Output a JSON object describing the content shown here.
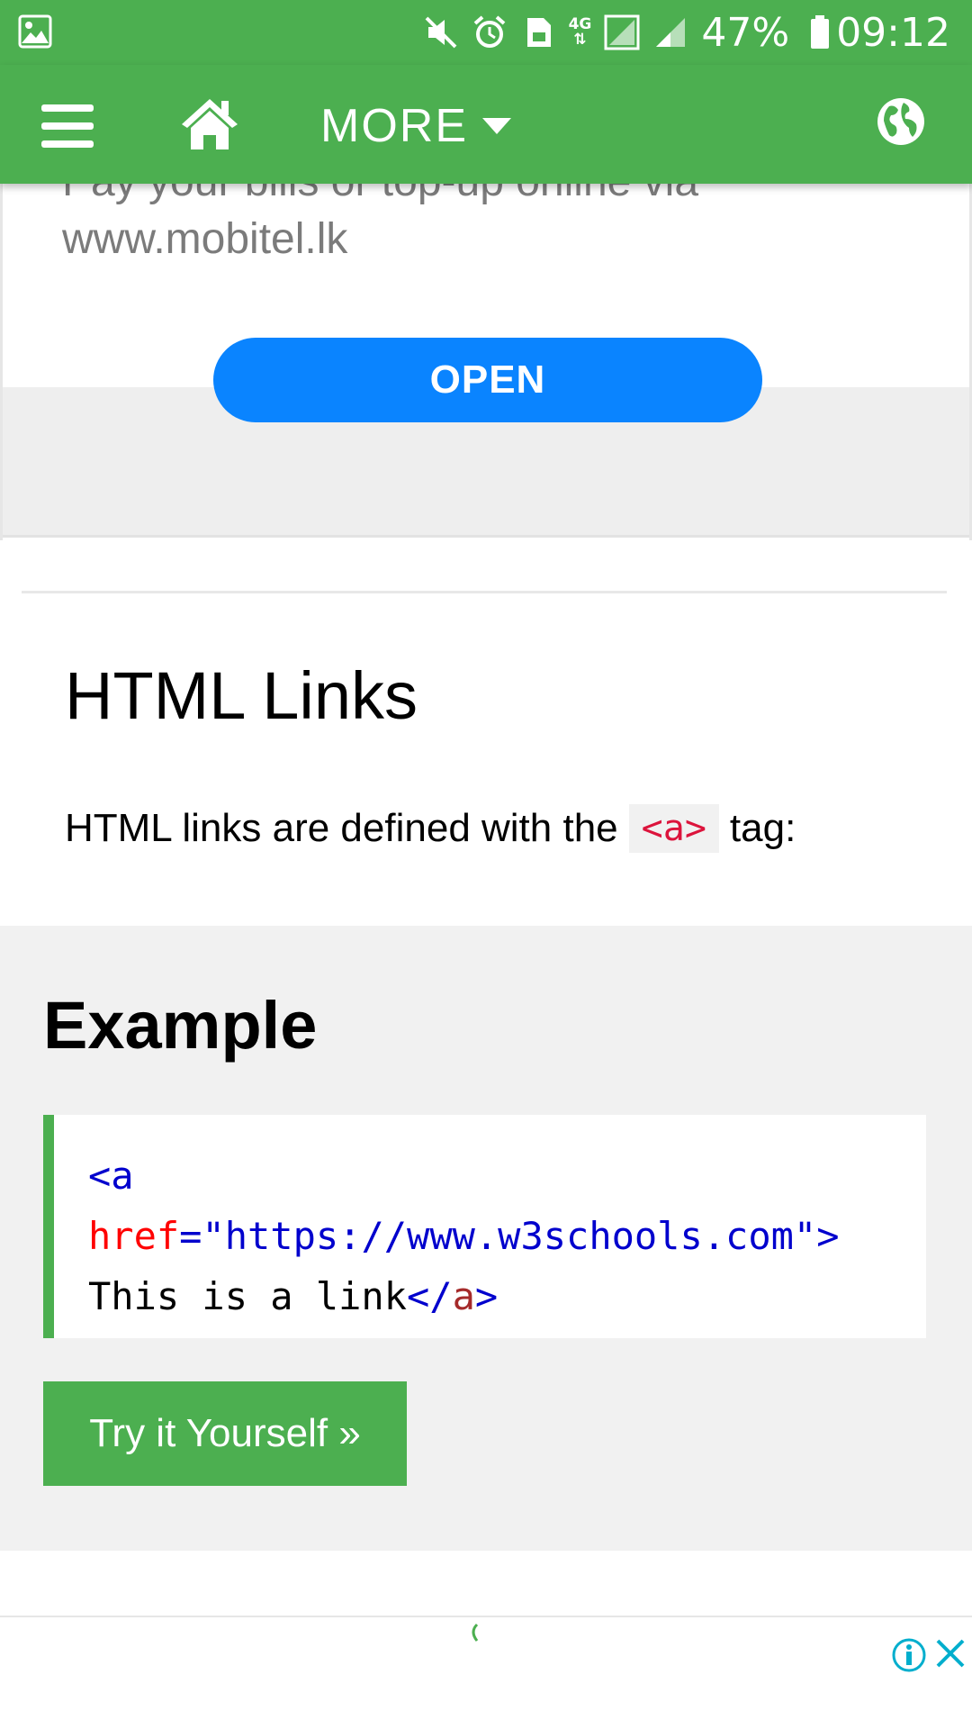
{
  "status_bar": {
    "battery": "47%",
    "time": "09:12",
    "network": "4G",
    "icons": [
      "gallery-icon",
      "mute-icon",
      "alarm-icon",
      "sim-icon",
      "signal-icon",
      "battery-icon"
    ]
  },
  "nav": {
    "more_label": "MORE",
    "icons": [
      "menu-icon",
      "home-icon",
      "globe-icon"
    ],
    "color": "#4CAF50"
  },
  "ad": {
    "text": "Pay your bills or top-up online via www.mobitel.lk",
    "button_label": "OPEN",
    "button_color": "#0A84FF"
  },
  "article": {
    "title": "HTML Links",
    "intro_before": "HTML links are defined with the",
    "intro_code": "<a>",
    "intro_after": "tag:"
  },
  "example": {
    "title": "Example",
    "code": {
      "open_tag": "<a",
      "attr_name": "href",
      "attr_eq": "=",
      "attr_value": "\"https://www.w3schools.com\"",
      "tag_close": ">",
      "text": "This is a link",
      "end_open": "</",
      "end_name": "a",
      "end_close": ">"
    },
    "try_button": "Try it Yourself »"
  }
}
